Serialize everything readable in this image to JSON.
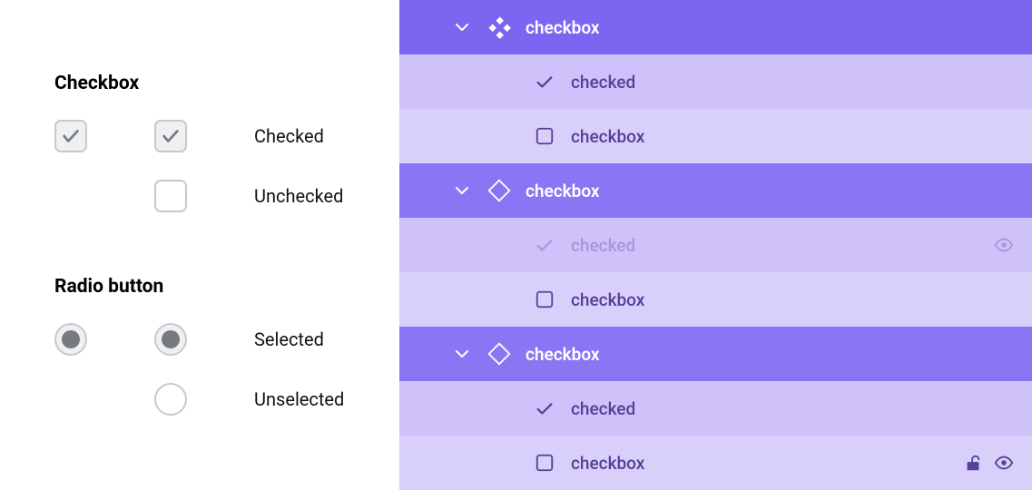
{
  "left": {
    "checkbox_section_title": "Checkbox",
    "checked_label": "Checked",
    "unchecked_label": "Unchecked",
    "radio_section_title": "Radio button",
    "selected_label": "Selected",
    "unselected_label": "Unselected"
  },
  "layers": {
    "group1": {
      "parent_label": "checkbox",
      "child_checked_label": "checked",
      "child_checkbox_label": "checkbox"
    },
    "group2": {
      "parent_label": "checkbox",
      "child_checked_label": "checked",
      "child_checkbox_label": "checkbox"
    },
    "group3": {
      "parent_label": "checkbox",
      "child_checked_label": "checked",
      "child_checkbox_label": "checkbox"
    }
  },
  "colors": {
    "master_purple": "#7b66f2",
    "instance_purple": "#8976f4",
    "light_purple_a": "#d9cffb",
    "light_purple_b": "#cfc2fa",
    "text_purple": "#544198"
  }
}
